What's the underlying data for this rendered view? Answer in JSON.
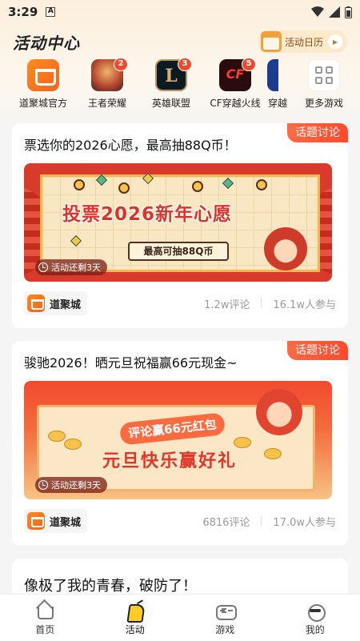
{
  "status_bar": {
    "time": "3:29",
    "notification_letter": "A"
  },
  "header": {
    "title": "活动中心",
    "calendar_label": "活动日历"
  },
  "games": [
    {
      "label": "道聚城官方",
      "badge": "",
      "icon": "mall-cart-icon"
    },
    {
      "label": "王者荣耀",
      "badge": "2",
      "icon": "honor-of-kings-icon"
    },
    {
      "label": "英雄联盟",
      "badge": "3",
      "icon": "league-of-legends-icon"
    },
    {
      "label": "CF穿越火线",
      "badge": "5",
      "icon": "crossfire-icon"
    },
    {
      "label": "更多游戏",
      "badge": "",
      "icon": "more-grid-icon"
    }
  ],
  "partial_game_label": "穿越",
  "cards": [
    {
      "tag": "话题讨论",
      "title": "票选你的2026心愿，最高抽88Q币！",
      "banner_headline": "投票2026新年心愿",
      "banner_sub": "最高可抽88Q币",
      "countdown": "活动还剩3天",
      "source": "道聚城",
      "comments": "1.2w评论",
      "participants": "16.1w人参与"
    },
    {
      "tag": "话题讨论",
      "title": "骏驰2026！晒元旦祝福赢66元现金~",
      "banner_pill": "评论赢66元红包",
      "banner_headline": "元旦快乐赢好礼",
      "countdown": "活动还剩3天",
      "source": "道聚城",
      "comments": "6816评论",
      "participants": "17.0w人参与"
    },
    {
      "title": "像极了我的青春，破防了！"
    }
  ],
  "bottom_nav": [
    {
      "label": "首页"
    },
    {
      "label": "活动"
    },
    {
      "label": "游戏"
    },
    {
      "label": "我的"
    }
  ],
  "colors": {
    "accent": "#ff4a2c",
    "brand_orange": "#f2641e",
    "badge": "#f04a2a"
  }
}
